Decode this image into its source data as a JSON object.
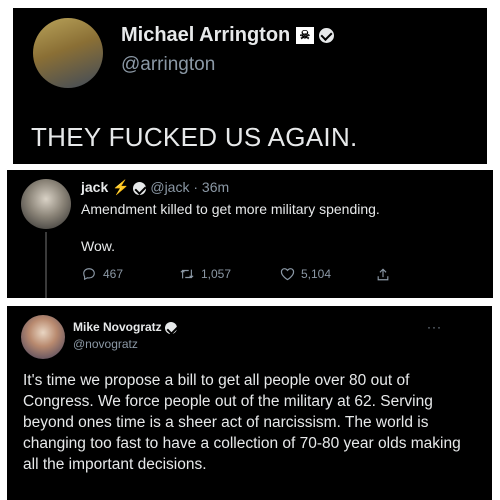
{
  "tweet1": {
    "name": "Michael Arrington",
    "flag_icon": "pirate-flag-icon",
    "handle": "@arrington",
    "text": "THEY FUCKED US AGAIN."
  },
  "tweet2": {
    "name": "jack",
    "emoji_icon": "lightning-icon",
    "handle": "@jack",
    "time": "· 36m",
    "line1": "Amendment killed to get more military spending.",
    "line2": "Wow.",
    "replies": "467",
    "retweets": "1,057",
    "likes": "5,104"
  },
  "tweet3": {
    "name": "Mike Novogratz",
    "handle": "@novogratz",
    "more": "···",
    "text": "It's time we propose a bill to get all people over 80 out of Congress.  We force people out of the military at 62. Serving beyond ones time is a sheer act of narcissism.  The world is changing too fast to have a collection of 70-80 year olds making all the important decisions."
  }
}
